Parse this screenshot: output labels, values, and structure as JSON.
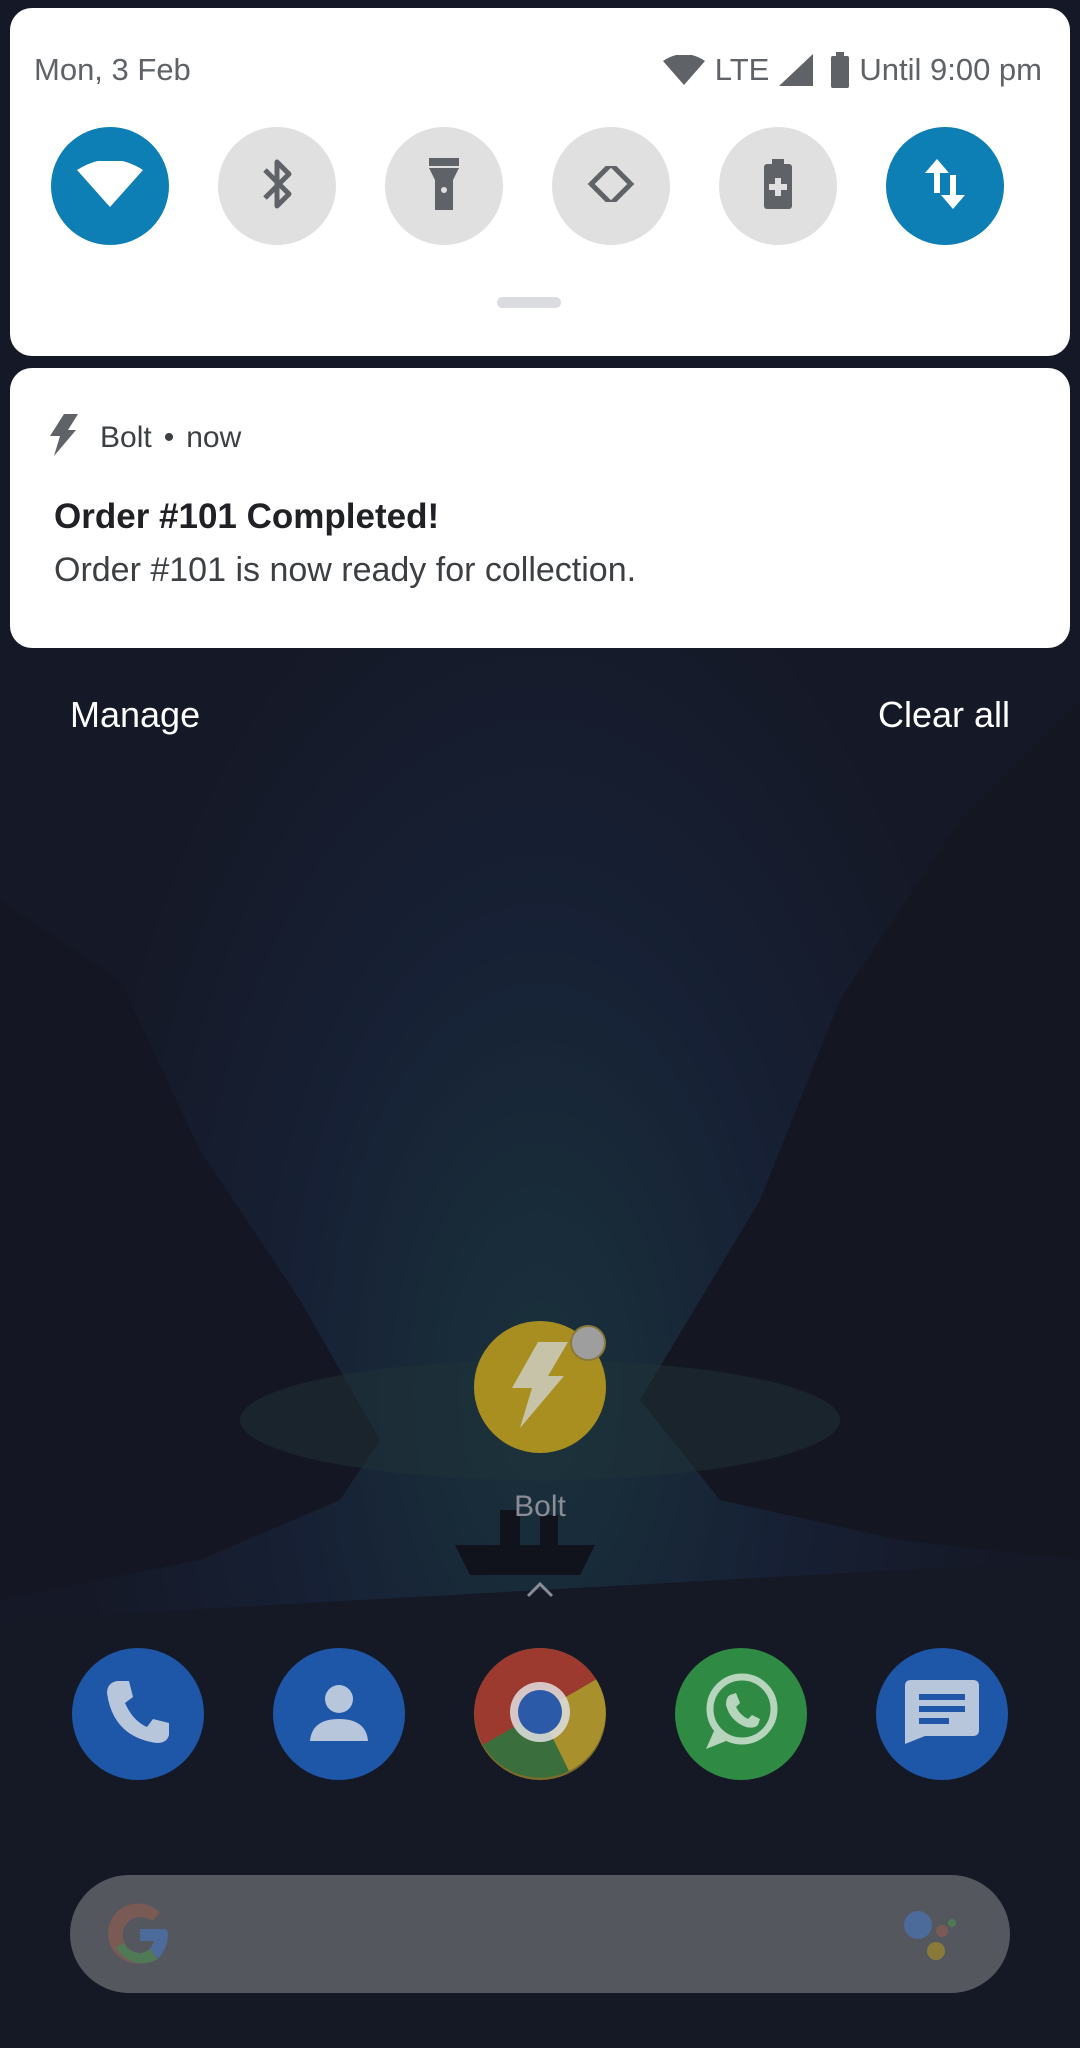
{
  "quick_settings": {
    "date": "Mon, 3 Feb",
    "network": "LTE",
    "battery_text": "Until 9:00 pm",
    "tiles": [
      {
        "name": "wifi",
        "icon": "wifi-icon",
        "active": true
      },
      {
        "name": "bluetooth",
        "icon": "bluetooth-icon",
        "active": false
      },
      {
        "name": "flashlight",
        "icon": "flashlight-icon",
        "active": false
      },
      {
        "name": "auto-rotate",
        "icon": "rotate-icon",
        "active": false
      },
      {
        "name": "battery-saver",
        "icon": "battery-saver-icon",
        "active": false
      },
      {
        "name": "mobile-data",
        "icon": "data-arrows-icon",
        "active": true
      }
    ]
  },
  "notification": {
    "app": "Bolt",
    "separator": "•",
    "time": "now",
    "title": "Order #101 Completed!",
    "text": "Order #101 is now ready for collection."
  },
  "actions": {
    "manage": "Manage",
    "clear_all": "Clear all"
  },
  "home": {
    "app_label": "Bolt",
    "dock": [
      "phone-icon",
      "contacts-icon",
      "chrome-icon",
      "whatsapp-icon",
      "messages-icon"
    ]
  },
  "colors": {
    "accent": "#0e7fb4",
    "bolt": "#c29f1c"
  }
}
